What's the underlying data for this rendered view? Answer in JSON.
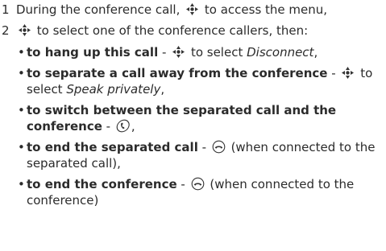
{
  "steps": [
    {
      "number": "1",
      "before": "During the conference call, ",
      "icon": "navigation-key-icon",
      "after": " to access the menu,"
    },
    {
      "number": "2",
      "before": "",
      "icon": "navigation-key-icon",
      "after": " to select one of the conference callers, then:"
    }
  ],
  "bullets": [
    {
      "symbol": "•",
      "lead": "to hang up this call",
      "sep": " - ",
      "icon": "navigation-key-icon",
      "text_before_em": " to select ",
      "em": "Disconnect",
      "text_after_em": ","
    },
    {
      "symbol": "•",
      "lead": "to separate a call away from the conference",
      "sep": " - ",
      "icon": "navigation-key-icon",
      "text_before_em": " to select ",
      "em": "Speak privately",
      "text_after_em": ","
    },
    {
      "symbol": "•",
      "lead": "to switch between the separated call and the conference",
      "sep": " - ",
      "icon": "call-key-icon",
      "text_after_icon": ","
    },
    {
      "symbol": "•",
      "lead": "to end the separated call",
      "sep": " - ",
      "icon": "end-call-key-icon",
      "text_after_icon": " (when connected to the separated call),"
    },
    {
      "symbol": "•",
      "lead": "to end the conference",
      "sep": " - ",
      "icon": "end-call-key-icon",
      "text_after_icon": " (when connected to the conference)"
    }
  ]
}
